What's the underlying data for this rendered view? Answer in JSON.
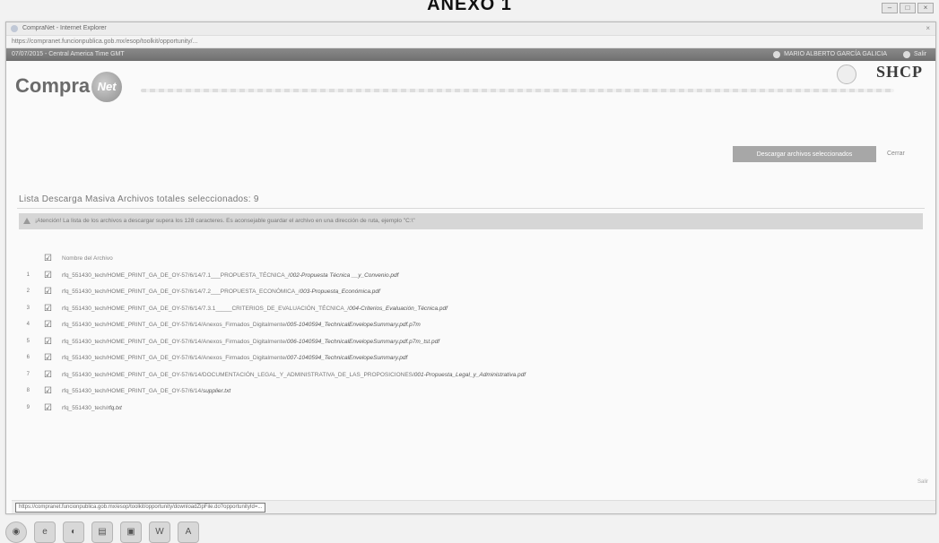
{
  "document": {
    "heading": "ANEXO 1"
  },
  "browser": {
    "window_title": "CompraNet - Internet Explorer",
    "address": "https://compranet.funcionpublica.gob.mx/esop/toolkit/opportunity/...",
    "topbar_left": "07/07/2015 - Central America Time GMT",
    "topbar_user": "MARIO ALBERTO GARCÍA GALICIA",
    "topbar_exit": "Salir"
  },
  "site": {
    "logo_text": "Compra",
    "logo_badge": "Net",
    "agency": "SHCP"
  },
  "actions": {
    "download_button": "Descargar archivos seleccionados",
    "close_link": "Cerrar"
  },
  "section": {
    "title": "Lista Descarga Masiva Archivos totales seleccionados: 9"
  },
  "alert": {
    "text": "¡Atención! La lista de los archivos a descargar supera los 128 caracteres. Es aconsejable guardar el archivo en una dirección de ruta, ejemplo \"C:\\\""
  },
  "files": {
    "header": "Nombre del Archivo",
    "items": [
      {
        "num": "1",
        "prefix": "rfq_551430_tech/HOME_PRINT_GA_DE_OY-57/6/14/7.1___PROPUESTA_TÉCNICA_/",
        "name": "002-Propuesta Técnica __y_Convenio.pdf"
      },
      {
        "num": "2",
        "prefix": "rfq_551430_tech/HOME_PRINT_GA_DE_OY-57/6/14/7.2___PROPUESTA_ECONÓMICA_/",
        "name": "003-Propuesta_Económica.pdf"
      },
      {
        "num": "3",
        "prefix": "rfq_551430_tech/HOME_PRINT_GA_DE_OY-57/6/14/7.3.1_____CRITERIOS_DE_EVALUACIÓN_TÉCNICA_/",
        "name": "004-Criterios_Evaluación_Técnica.pdf"
      },
      {
        "num": "4",
        "prefix": "rfq_551430_tech/HOME_PRINT_GA_DE_OY-57/6/14/Anexos_Firmados_Digitalmente/",
        "name": "005-1040594_TechnicalEnvelopeSummary.pdf.p7m"
      },
      {
        "num": "5",
        "prefix": "rfq_551430_tech/HOME_PRINT_GA_DE_OY-57/6/14/Anexos_Firmados_Digitalmente/",
        "name": "006-1040594_TechnicalEnvelopeSummary.pdf.p7m_tst.pdf"
      },
      {
        "num": "6",
        "prefix": "rfq_551430_tech/HOME_PRINT_GA_DE_OY-57/6/14/Anexos_Firmados_Digitalmente/",
        "name": "007-1040594_TechnicalEnvelopeSummary.pdf"
      },
      {
        "num": "7",
        "prefix": "rfq_551430_tech/HOME_PRINT_GA_DE_OY-57/6/14/DOCUMENTACIÓN_LEGAL_Y_ADMINISTRATIVA_DE_LAS_PROPOSICIONES/",
        "name": "001-Propuesta_Legal_y_Administrativa.pdf"
      },
      {
        "num": "8",
        "prefix": "rfq_551430_tech/HOME_PRINT_GA_DE_OY-57/6/14/",
        "name": "supplier.txt"
      },
      {
        "num": "9",
        "prefix": "rfq_551430_tech/",
        "name": "rfq.txt"
      }
    ]
  },
  "status": {
    "url": "https://compranet.funcionpublica.gob.mx/esop/toolkit/opportunity/downloadZipFile.do?opportunityId=..."
  },
  "side_label": "Salir"
}
